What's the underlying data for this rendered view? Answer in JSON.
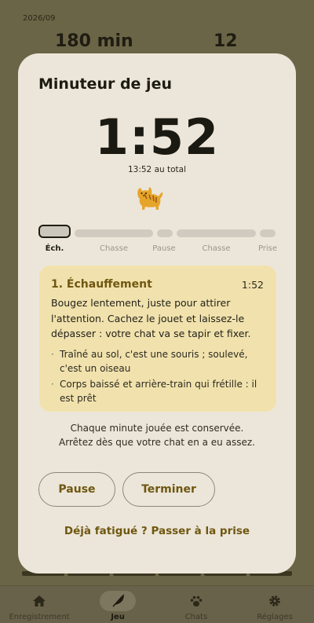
{
  "background": {
    "date": "2026/09",
    "stat_minutes": "180 min",
    "stat_count": "12"
  },
  "nav": {
    "items": [
      {
        "label": "Enregistrement",
        "icon": "home-icon"
      },
      {
        "label": "Jeu",
        "icon": "feather-icon"
      },
      {
        "label": "Chats",
        "icon": "paw-icon"
      },
      {
        "label": "Réglages",
        "icon": "gear-icon"
      }
    ],
    "active_index": 1
  },
  "modal": {
    "title": "Minuteur de jeu",
    "timer": "1:52",
    "total": "13:52 au total",
    "phases": [
      {
        "label": "Éch.",
        "active": true
      },
      {
        "label": "Chasse",
        "active": false
      },
      {
        "label": "Pause",
        "active": false
      },
      {
        "label": "Chasse",
        "active": false
      },
      {
        "label": "Prise",
        "active": false
      }
    ],
    "card": {
      "title": "1. Échauffement",
      "time": "1:52",
      "text": "Bougez lentement, juste pour attirer l'attention. Cachez le jouet et laissez-le dépasser : votre chat va se tapir et fixer.",
      "bullets": [
        "Traîné au sol, c'est une souris ; soulevé, c'est un oiseau",
        "Corps baissé et arrière-train qui frétille : il est prêt"
      ]
    },
    "note_line1": "Chaque minute jouée est conservée.",
    "note_line2": "Arrêtez dès que votre chat en a eu assez.",
    "pause_label": "Pause",
    "end_label": "Terminer",
    "skip_label": "Déjà fatigué ? Passer à la prise"
  },
  "colors": {
    "accent": "#6f5710",
    "card_bg": "#f1e2ad",
    "modal_bg": "#ece6da",
    "scrim": "#6b6547"
  }
}
